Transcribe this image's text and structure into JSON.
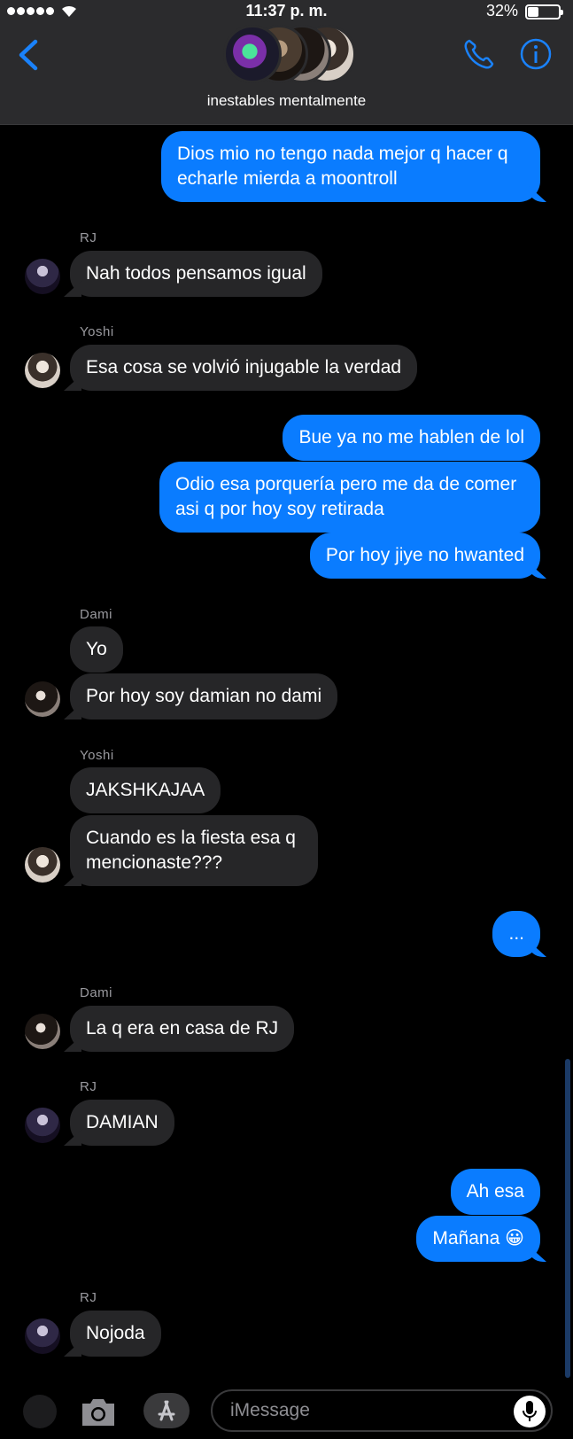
{
  "status_bar": {
    "time": "11:37 p. m.",
    "battery": "32%",
    "battery_level": 0.32
  },
  "header": {
    "group_name": "inestables mentalmente"
  },
  "messages": [
    {
      "from": "me",
      "text": "Dios mio no tengo nada mejor q hacer q echarle mierda a moontroll"
    },
    {
      "sender": "RJ",
      "text": "Nah todos pensamos igual"
    },
    {
      "sender": "Yoshi",
      "text": "Esa cosa se volvió injugable la verdad"
    },
    {
      "from": "me",
      "text": "Bue ya no me hablen de lol"
    },
    {
      "from": "me",
      "text": "Odio esa porquería pero me da de comer asi q por hoy soy retirada"
    },
    {
      "from": "me",
      "text": "Por hoy jiye no hwanted"
    },
    {
      "sender": "Dami",
      "text": "Yo"
    },
    {
      "sender": "Dami",
      "text": "Por hoy soy damian no dami"
    },
    {
      "sender": "Yoshi",
      "text": "JAKSHKAJAA"
    },
    {
      "sender": "Yoshi",
      "text": "Cuando es la fiesta esa q mencionaste???"
    },
    {
      "from": "me",
      "text": "..."
    },
    {
      "sender": "Dami",
      "text": "La q era en casa de RJ"
    },
    {
      "sender": "RJ",
      "text": "DAMIAN"
    },
    {
      "from": "me",
      "text": "Ah esa"
    },
    {
      "from": "me",
      "text": "Mañana 😀"
    },
    {
      "sender": "RJ",
      "text": "Nojoda"
    }
  ],
  "input": {
    "placeholder": "iMessage"
  },
  "colors": {
    "outgoing": "#0a7cff",
    "incoming": "#262628",
    "accent": "#1a82fb"
  }
}
